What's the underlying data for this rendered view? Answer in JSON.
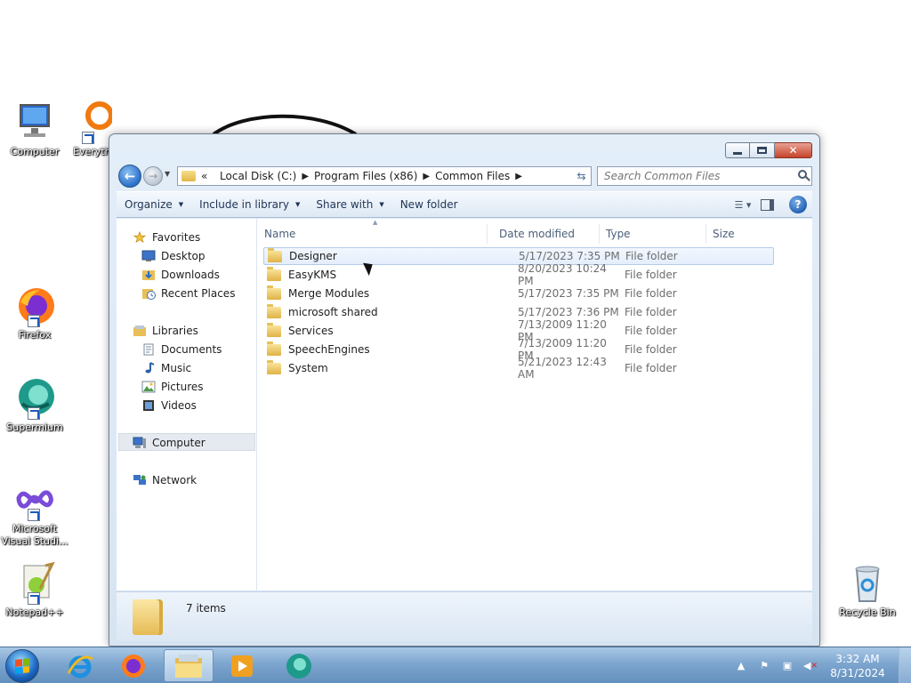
{
  "desktop": {
    "icons": [
      {
        "label": "Computer"
      },
      {
        "label": "Everything"
      },
      {
        "label": "Firefox"
      },
      {
        "label": "Supermium"
      },
      {
        "label": "Microsoft Visual Studi..."
      },
      {
        "label": "Notepad++"
      },
      {
        "label": "Recycle Bin"
      }
    ]
  },
  "window": {
    "address": {
      "overflow": "«",
      "crumbs": [
        "Local Disk (C:)",
        "Program Files (x86)",
        "Common Files"
      ]
    },
    "search_placeholder": "Search Common Files",
    "toolbar": {
      "organize": "Organize",
      "include_in_library": "Include in library",
      "share_with": "Share with",
      "new_folder": "New folder"
    },
    "nav": {
      "favorites": "Favorites",
      "desktop": "Desktop",
      "downloads": "Downloads",
      "recent_places": "Recent Places",
      "libraries": "Libraries",
      "documents": "Documents",
      "music": "Music",
      "pictures": "Pictures",
      "videos": "Videos",
      "computer": "Computer",
      "network": "Network"
    },
    "columns": {
      "name": "Name",
      "date": "Date modified",
      "type": "Type",
      "size": "Size"
    },
    "files": [
      {
        "name": "Designer",
        "date": "5/17/2023 7:35 PM",
        "type": "File folder"
      },
      {
        "name": "EasyKMS",
        "date": "8/20/2023 10:24 PM",
        "type": "File folder"
      },
      {
        "name": "Merge Modules",
        "date": "5/17/2023 7:35 PM",
        "type": "File folder"
      },
      {
        "name": "microsoft shared",
        "date": "5/17/2023 7:36 PM",
        "type": "File folder"
      },
      {
        "name": "Services",
        "date": "7/13/2009 11:20 PM",
        "type": "File folder"
      },
      {
        "name": "SpeechEngines",
        "date": "7/13/2009 11:20 PM",
        "type": "File folder"
      },
      {
        "name": "System",
        "date": "5/21/2023 12:43 AM",
        "type": "File folder"
      }
    ],
    "status": {
      "count": "7 items"
    }
  },
  "taskbar": {
    "clock": {
      "time": "3:32 AM",
      "date": "8/31/2024"
    }
  }
}
